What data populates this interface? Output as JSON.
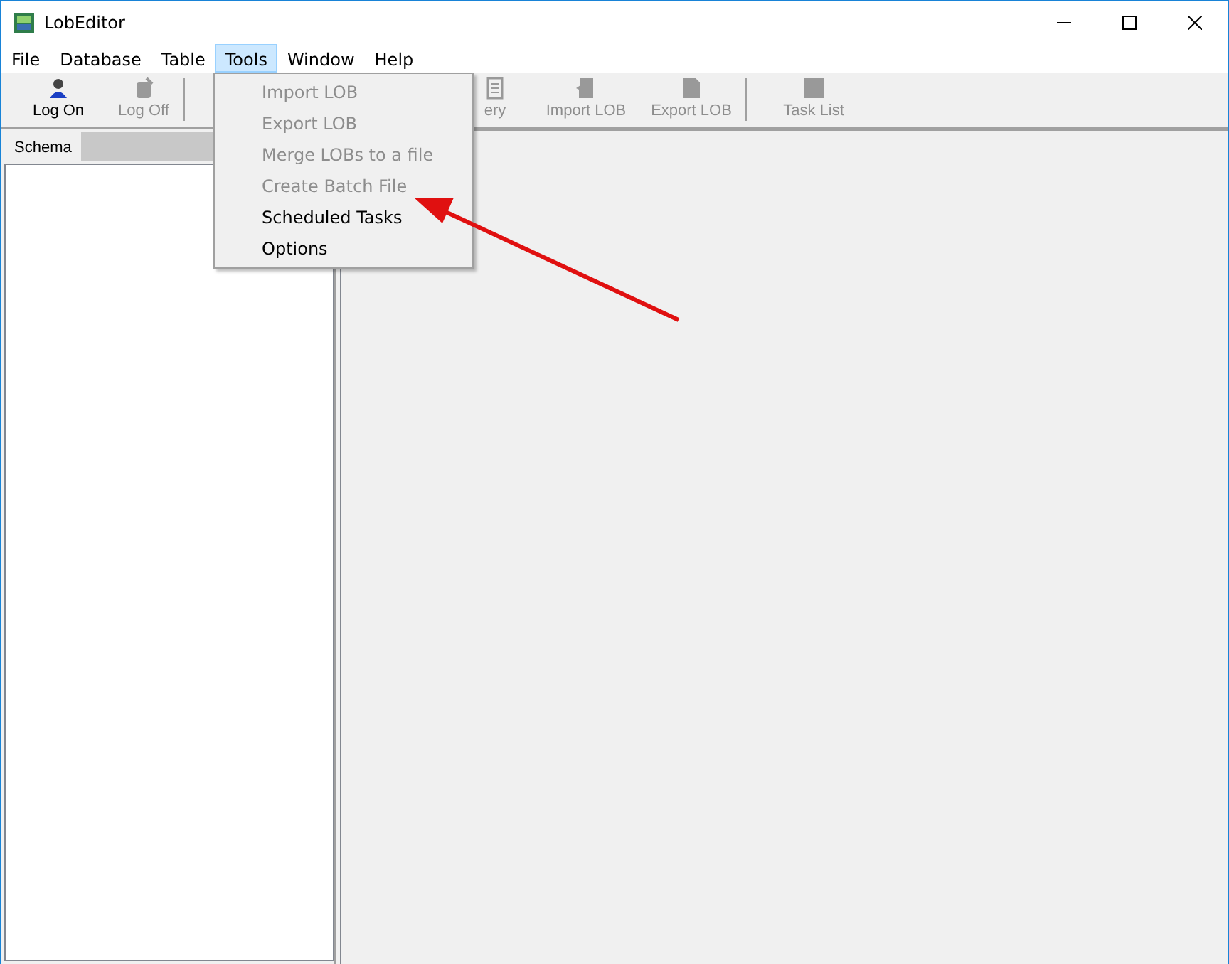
{
  "window": {
    "title": "LobEditor"
  },
  "menu_bar": [
    {
      "label": "File",
      "selected": false
    },
    {
      "label": "Database",
      "selected": false
    },
    {
      "label": "Table",
      "selected": false
    },
    {
      "label": "Tools",
      "selected": true
    },
    {
      "label": "Window",
      "selected": false
    },
    {
      "label": "Help",
      "selected": false
    }
  ],
  "toolbar": [
    {
      "kind": "button",
      "label": "Log On",
      "disabled": false
    },
    {
      "kind": "button",
      "label": "Log Off",
      "disabled": true
    },
    {
      "kind": "separator"
    },
    {
      "kind": "partial",
      "label": "ery",
      "disabled": true
    },
    {
      "kind": "button",
      "label": "Import LOB",
      "disabled": true
    },
    {
      "kind": "button",
      "label": "Export LOB",
      "disabled": true
    },
    {
      "kind": "separator"
    },
    {
      "kind": "button",
      "label": "Task List",
      "disabled": true
    }
  ],
  "tabs": [
    {
      "label": "Schema",
      "selected": true
    }
  ],
  "tools_menu": [
    {
      "label": "Import LOB",
      "disabled": true
    },
    {
      "label": "Export LOB",
      "disabled": true
    },
    {
      "label": "Merge LOBs to a file",
      "disabled": true
    },
    {
      "label": "Create Batch File",
      "disabled": true
    },
    {
      "label": "Scheduled Tasks",
      "disabled": false
    },
    {
      "label": "Options",
      "disabled": false
    }
  ]
}
